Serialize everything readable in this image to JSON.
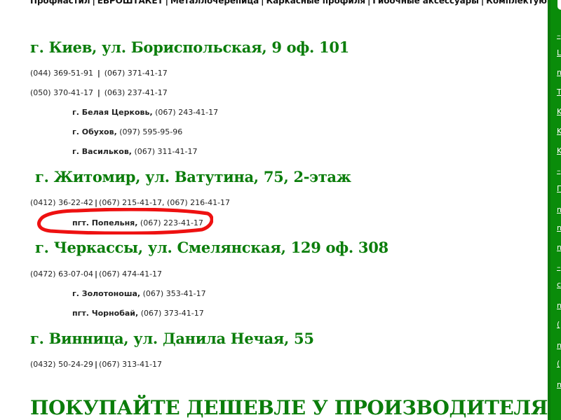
{
  "topnav": {
    "items": [
      "Профнастил",
      "ЕВРОШТАКЕТ",
      "Металлочерепица",
      "Каркасные профиля",
      "Гибочные аксессуары",
      "Комплектующие"
    ],
    "separator": "|"
  },
  "offices": [
    {
      "heading": "г. Киев, ул. Бориспольская, 9 оф. 101",
      "phone_lines": [
        [
          "(044) 369-51-91",
          "(067) 371-41-17"
        ],
        [
          "(050) 370-41-17",
          "(063) 237-41-17"
        ]
      ],
      "branches": [
        {
          "city": "г. Белая Церковь,",
          "phone": "(067) 243-41-17"
        },
        {
          "city": "г. Обухов,",
          "phone": "(097) 595-95-96"
        },
        {
          "city": "г. Васильков,",
          "phone": "(067) 311-41-17"
        }
      ]
    },
    {
      "heading": "г. Житомир, ул. Ватутина, 75, 2-этаж",
      "phone_lines": [
        [
          "(0412) 36-22-42",
          "(067) 215-41-17, (067) 216-41-17"
        ]
      ],
      "branches": [
        {
          "city": "пгт. Попельня,",
          "phone": "(067) 223-41-17"
        }
      ]
    },
    {
      "heading": "г. Черкассы, ул. Смелянская, 129 оф. 308",
      "phone_lines": [
        [
          "(0472) 63-07-04",
          "(067) 474-41-17"
        ]
      ],
      "branches": [
        {
          "city": "г. Золотоноша,",
          "phone": "(067) 353-41-17"
        },
        {
          "city": "пгт. Чорнобай,",
          "phone": "(067) 373-41-17"
        }
      ]
    },
    {
      "heading": "г. Винница, ул. Данила Нечая, 55",
      "phone_lines": [
        [
          "(0432) 50-24-29",
          "(067) 313-41-17"
        ]
      ],
      "branches": []
    }
  ],
  "promo": "ПОКУПАЙТЕ ДЕШЕВЛЕ У ПРОИЗВОДИТЕЛЯ!",
  "sidebar": {
    "fragments": [
      "–",
      "L",
      "n",
      "T",
      "K",
      "K",
      "K",
      "–",
      "П",
      "n",
      "n",
      "n",
      "–",
      "c",
      "n",
      "(",
      "n",
      "(",
      "n"
    ]
  },
  "colors": {
    "heading_green": "#0b7d0b",
    "sidebar_green": "#0a8c0a",
    "annotation_red": "#ee1111"
  }
}
